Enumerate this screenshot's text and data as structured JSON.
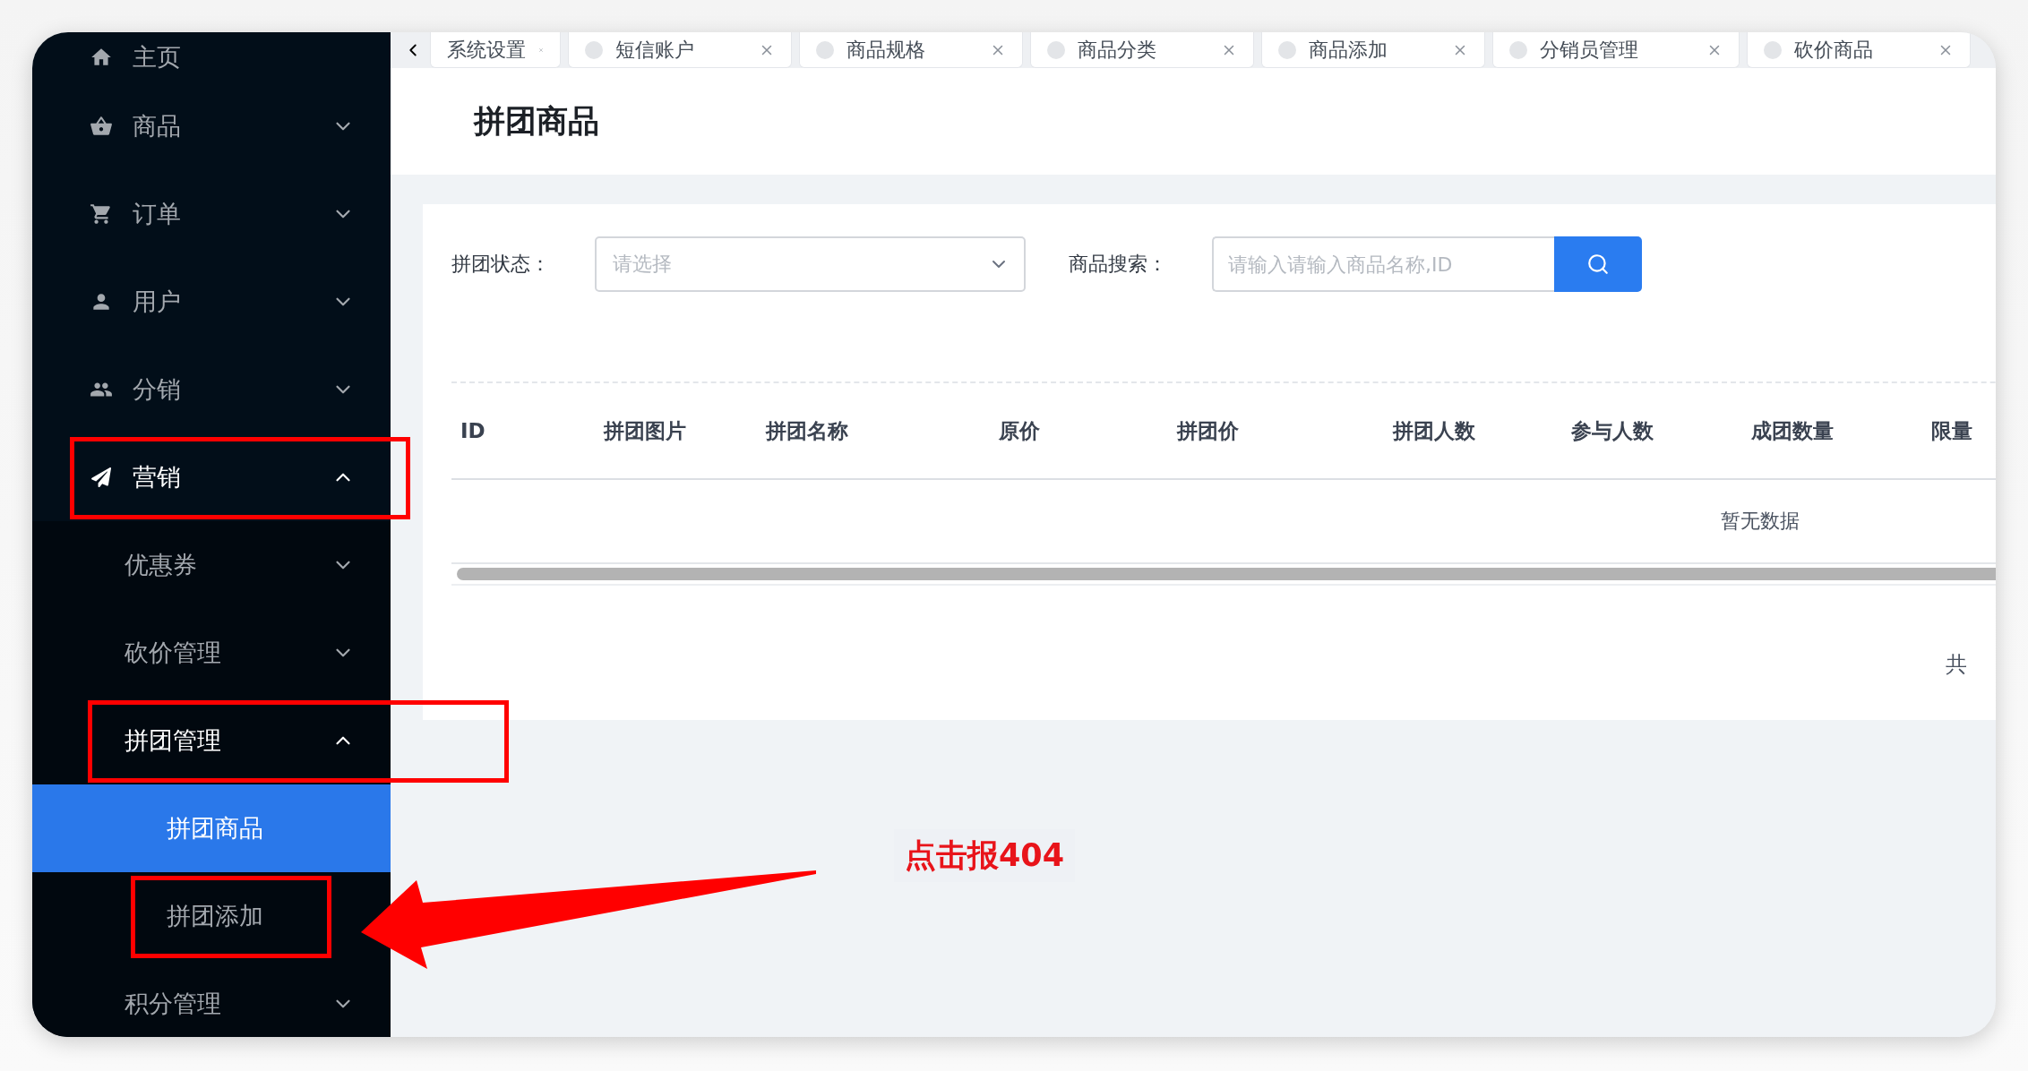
{
  "tabs": [
    {
      "label": "系统设置",
      "dot": false,
      "selected": false
    },
    {
      "label": "短信账户",
      "dot": true,
      "selected": false
    },
    {
      "label": "商品规格",
      "dot": true,
      "selected": false
    },
    {
      "label": "商品分类",
      "dot": true,
      "selected": false
    },
    {
      "label": "商品添加",
      "dot": true,
      "selected": false
    },
    {
      "label": "分销员管理",
      "dot": true,
      "selected": false
    },
    {
      "label": "砍价商品",
      "dot": true,
      "selected": false
    }
  ],
  "sidebar": {
    "items": [
      {
        "label": "主页",
        "selected": false,
        "highlighted": false
      },
      {
        "label": "商品",
        "expanded": false,
        "selected": false,
        "highlighted": false
      },
      {
        "label": "订单",
        "expanded": false,
        "selected": false,
        "highlighted": false
      },
      {
        "label": "用户",
        "expanded": false,
        "selected": false,
        "highlighted": false
      },
      {
        "label": "分销",
        "expanded": false,
        "selected": false,
        "highlighted": false
      },
      {
        "label": "营销",
        "expanded": true,
        "selected": false,
        "highlighted": true,
        "children": [
          {
            "label": "优惠券",
            "expanded": false,
            "selected": false,
            "highlighted": false
          },
          {
            "label": "砍价管理",
            "expanded": false,
            "selected": false,
            "highlighted": false
          },
          {
            "label": "拼团管理",
            "expanded": true,
            "selected": false,
            "highlighted": true,
            "children": [
              {
                "label": "拼团商品",
                "selected": true,
                "highlighted": false
              },
              {
                "label": "拼团添加",
                "selected": false,
                "highlighted": true
              }
            ]
          },
          {
            "label": "积分管理",
            "expanded": false,
            "selected": false,
            "highlighted": false
          }
        ]
      }
    ]
  },
  "page_title": "拼团商品",
  "filters": {
    "status_label": "拼团状态：",
    "status_placeholder": "请选择",
    "search_label": "商品搜索：",
    "search_placeholder": "请输入请输入商品名称,ID"
  },
  "table": {
    "columns": [
      "ID",
      "拼团图片",
      "拼团名称",
      "原价",
      "拼团价",
      "拼团人数",
      "参与人数",
      "成团数量",
      "限量"
    ],
    "empty_text": "暂无数据"
  },
  "pagination": {
    "text": "共"
  },
  "annotation": {
    "text": "点击报404"
  }
}
